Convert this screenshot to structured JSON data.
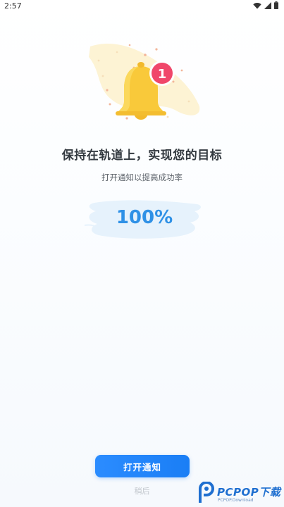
{
  "status_bar": {
    "time": "2:57"
  },
  "illustration": {
    "icon": "bell-icon",
    "badge_count": "1",
    "colors": {
      "bell": "#f9c93a",
      "badge": "#f0476a",
      "splash": "#fdf3d4"
    }
  },
  "headline": "保持在轨道上，实现您的目标",
  "subline": "打开通知以提高成功率",
  "success_rate": "100%",
  "primary_button": {
    "label": "打开通知",
    "color": "#1a7ef5"
  },
  "later_link": "稍后",
  "watermark": {
    "brand": "PCPOP下载",
    "sub": "PCPOP.Download"
  }
}
